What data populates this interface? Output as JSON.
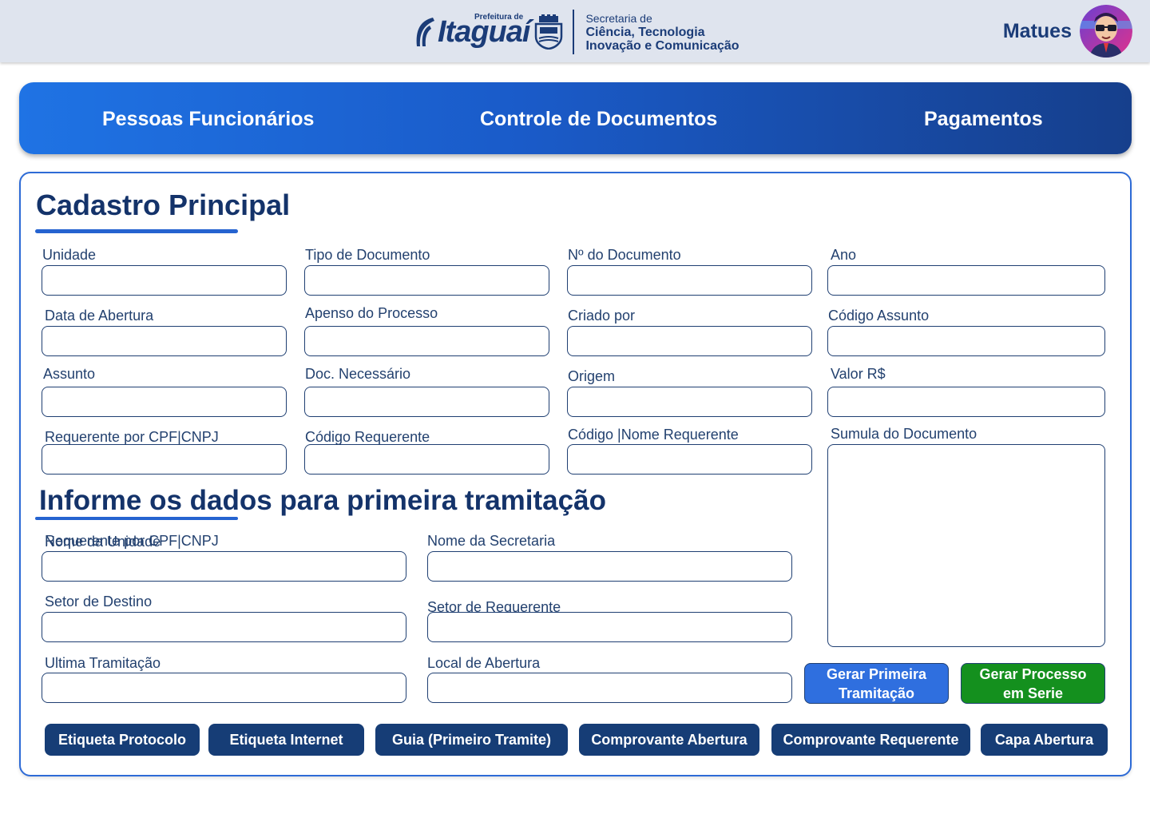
{
  "header": {
    "brand_prefix": "Prefeitura de",
    "brand_name": "Itaguaí",
    "secretaria_line1": "Secretaria de",
    "secretaria_line2": "Ciência, Tecnologia",
    "secretaria_line3": "Inovação e Comunicação",
    "user_name": "Matues"
  },
  "nav": {
    "items": [
      "Pessoas Funcionários",
      "Controle de Documentos",
      "Pagamentos"
    ]
  },
  "cadastro": {
    "title": "Cadastro Principal",
    "labels": {
      "unidade": "Unidade",
      "tipo_documento": "Tipo de Documento",
      "numero_documento": "Nº do Documento",
      "ano": "Ano",
      "data_abertura": "Data de Abertura",
      "apenso_processo": "Apenso do Processo",
      "criado_por": "Criado por",
      "codigo_assunto": "Código Assunto",
      "assunto": "Assunto",
      "doc_necessario": "Doc. Necessário",
      "origem": "Origem",
      "valor": "Valor R$",
      "requerente_cpf_cnpj": "Requerente por CPF|CNPJ",
      "codigo_requerente": "Código Requerente",
      "codigo_nome_requerente": "Código |Nome Requerente",
      "sumula_documento": "Sumula do Documento"
    }
  },
  "tramitacao": {
    "title": "Informe os dados para primeira tramitação",
    "labels": {
      "overlap_a": "Requerente por CPF|CNPJ",
      "overlap_b": "Nome da Unidade",
      "nome_secretaria": "Nome da Secretaria",
      "setor_destino": "Setor de Destino",
      "setor_requerente": "Setor de Requerente",
      "ultima_tramitacao": "Ultima Tramitação",
      "local_abertura": "Local de Abertura"
    }
  },
  "actions": {
    "gerar_primeira": "Gerar Primeira\nTramitação",
    "gerar_serie": "Gerar Processo\nem Serie",
    "etiqueta_protocolo": "Etiqueta Protocolo",
    "etiqueta_internet": "Etiqueta Internet",
    "guia": "Guia (Primeiro Tramite)",
    "comprovante_abertura": "Comprovante Abertura",
    "comprovante_requerente": "Comprovante Requerente",
    "capa_abertura": "Capa Abertura"
  },
  "colors": {
    "brand_dark": "#163d76",
    "nav_start": "#1f73e4",
    "nav_end": "#163f8c",
    "btn_blue": "#2f6fdf",
    "btn_green": "#14901e"
  },
  "icons": {
    "brand_logo": "itaguai-logo-icon",
    "crest": "city-crest-icon",
    "avatar": "user-avatar"
  }
}
